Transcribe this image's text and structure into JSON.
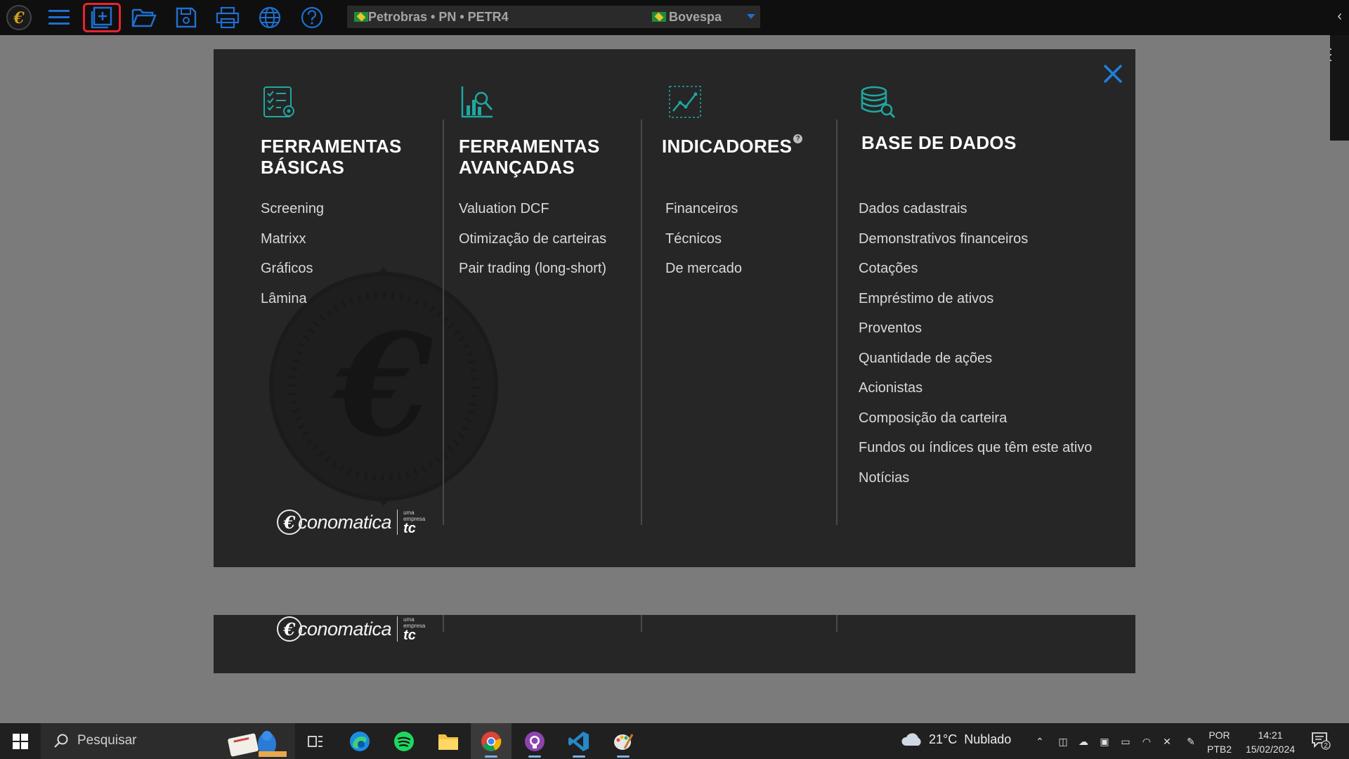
{
  "toolbar": {
    "asset": "Petrobras • PN • PETR4",
    "exchange": "Bovespa"
  },
  "modal": {
    "columns": [
      {
        "title_line1": "FERRAMENTAS",
        "title_line2": "BÁSICAS",
        "icon": "checklist-gear-icon",
        "items": [
          "Screening",
          "Matrixx",
          "Gráficos",
          "Lâmina"
        ]
      },
      {
        "title_line1": "FERRAMENTAS",
        "title_line2": "AVANÇADAS",
        "icon": "chart-magnifier-icon",
        "items": [
          "Valuation DCF",
          "Otimização de carteiras",
          "Pair trading (long-short)"
        ]
      },
      {
        "title_line1": "INDICADORES",
        "title_help": "?",
        "icon": "trend-chart-icon",
        "items": [
          "Financeiros",
          "Técnicos",
          "De mercado"
        ]
      },
      {
        "title_line1": "BASE DE DADOS",
        "icon": "database-search-icon",
        "items": [
          "Dados cadastrais",
          "Demonstrativos financeiros",
          "Cotações",
          "Empréstimo de ativos",
          "Proventos",
          "Quantidade de ações",
          "Acionistas",
          "Composição da carteira",
          "Fundos ou índices que têm este ativo",
          "Notícias"
        ]
      }
    ],
    "brand": {
      "e_glyph": "€",
      "name": "conomatica",
      "sub_line1": "uma",
      "sub_line2": "empresa",
      "sub_mark": "tc"
    }
  },
  "taskbar": {
    "search_placeholder": "Pesquisar",
    "weather_temp": "21°C",
    "weather_desc": "Nublado",
    "lang_line1": "POR",
    "lang_line2": "PTB2",
    "time": "14:21",
    "date": "15/02/2024",
    "notifications": "2"
  },
  "colors": {
    "accent_teal": "#1ea8a0",
    "accent_blue": "#1f6fd0",
    "highlight_red": "#e8242f",
    "modal_bg": "#262626"
  }
}
